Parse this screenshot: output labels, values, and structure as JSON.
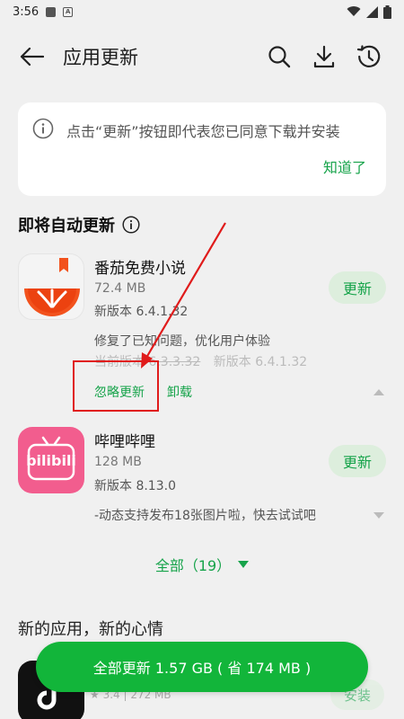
{
  "status_bar": {
    "time": "3:56"
  },
  "app_bar": {
    "title": "应用更新"
  },
  "notice": {
    "text": "点击“更新”按钮即代表您已同意下载并安装",
    "ack_label": "知道了"
  },
  "section_auto": {
    "title": "即将自动更新"
  },
  "apps": [
    {
      "name": "番茄免费小说",
      "size": "72.4 MB",
      "new_version": "新版本 6.4.1.32",
      "changelog": "修复了已知问题，优化用户体验",
      "current_version": "当前版本 6.3.3.32",
      "new_version_2": "新版本 6.4.1.32",
      "ignore_label": "忽略更新",
      "uninstall_label": "卸载",
      "update_label": "更新"
    },
    {
      "name": "哔哩哔哩",
      "size": "128 MB",
      "new_version": "新版本 8.13.0",
      "changelog": "-动态支持发布18张图片啦，快去试试吧",
      "update_label": "更新",
      "icon_text": "bilibili"
    }
  ],
  "all_row": {
    "label": "全部（19）"
  },
  "section_new": {
    "title": "新的应用，新的心情"
  },
  "peek_app": {
    "meta": "★ 3.4 | 272 MB",
    "install_label": "安装"
  },
  "bottom_button": {
    "label": "全部更新 1.57 GB ( 省 174 MB )"
  },
  "colors": {
    "accent": "#16a34a",
    "primary_button": "#12b53a",
    "annotation": "#e01b1b"
  }
}
